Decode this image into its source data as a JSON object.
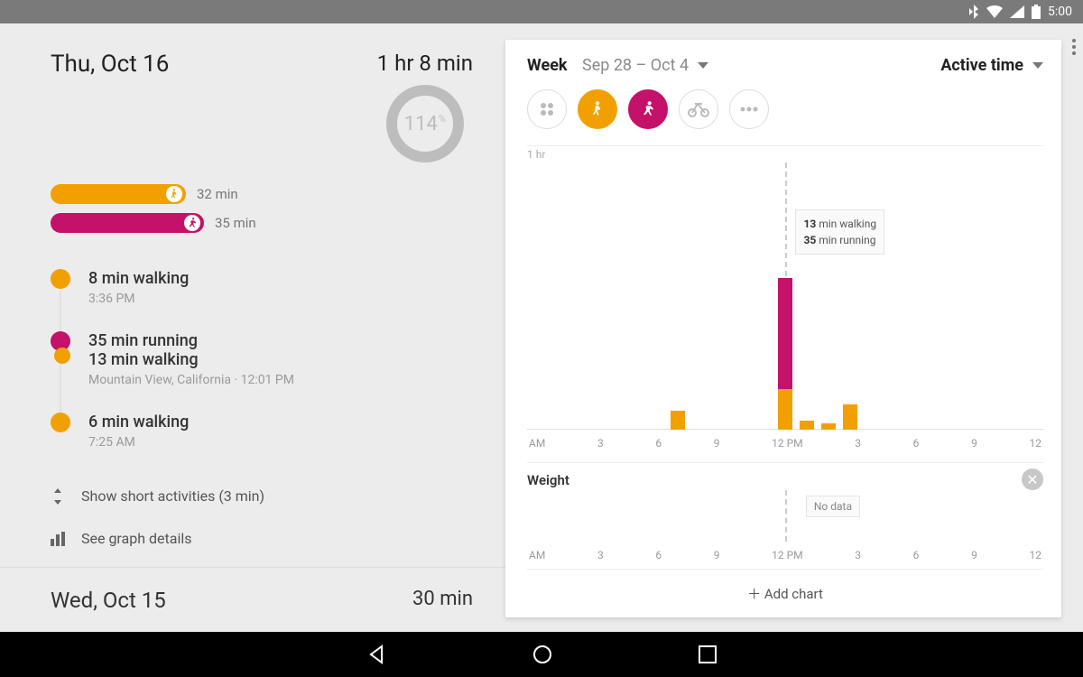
{
  "status": {
    "time": "5:00"
  },
  "colors": {
    "walk": "#f2a000",
    "run": "#c4116a",
    "muted": "#bdbdbd"
  },
  "today": {
    "title": "Thu, Oct 16",
    "total": "1 hr 8 min",
    "goal_percent": "114",
    "bars": [
      {
        "type": "walk",
        "label": "32 min",
        "width_pct": 46
      },
      {
        "type": "run",
        "label": "35 min",
        "width_pct": 52
      }
    ],
    "timeline": [
      {
        "dots": [
          "walk"
        ],
        "lines": [
          "8 min walking"
        ],
        "sub": "3:36 PM"
      },
      {
        "dots": [
          "run",
          "walk"
        ],
        "lines": [
          "35 min running",
          "13 min walking"
        ],
        "sub": "Mountain View, California · 12:01 PM"
      },
      {
        "dots": [
          "walk"
        ],
        "lines": [
          "6 min walking"
        ],
        "sub": "7:25 AM"
      }
    ],
    "show_short": "Show short activities (3 min)",
    "see_graph": "See graph details"
  },
  "prev_day": {
    "title": "Wed, Oct 15",
    "total": "30 min"
  },
  "card": {
    "range_label": "Week",
    "range_value": "Sep 28 – Oct 4",
    "metric": "Active time",
    "filters": [
      "all",
      "walk",
      "run",
      "bike",
      "more"
    ],
    "tooltip": {
      "line1_val": "13",
      "line1_txt": "min walking",
      "line2_val": "35",
      "line2_txt": "min running"
    },
    "weight_title": "Weight",
    "weight_nodata": "No data",
    "add_chart": "Add chart"
  },
  "chart_data": {
    "type": "bar",
    "title": "Active time",
    "ylabel": "hr",
    "ylim": [
      0,
      1
    ],
    "x_ticks": [
      "AM",
      "3",
      "6",
      "9",
      "12 PM",
      "3",
      "6",
      "9",
      "12"
    ],
    "x_hours": [
      0,
      3,
      6,
      9,
      12,
      15,
      18,
      21,
      24
    ],
    "series": [
      {
        "name": "walking",
        "color": "#f2a000"
      },
      {
        "name": "running",
        "color": "#c4116a"
      }
    ],
    "bars": [
      {
        "hour": 7,
        "walking_min": 6,
        "running_min": 0
      },
      {
        "hour": 12,
        "walking_min": 13,
        "running_min": 35
      },
      {
        "hour": 13,
        "walking_min": 3,
        "running_min": 0
      },
      {
        "hour": 14,
        "walking_min": 2,
        "running_min": 0
      },
      {
        "hour": 15,
        "walking_min": 8,
        "running_min": 0
      }
    ],
    "cursor_hour": 12
  }
}
